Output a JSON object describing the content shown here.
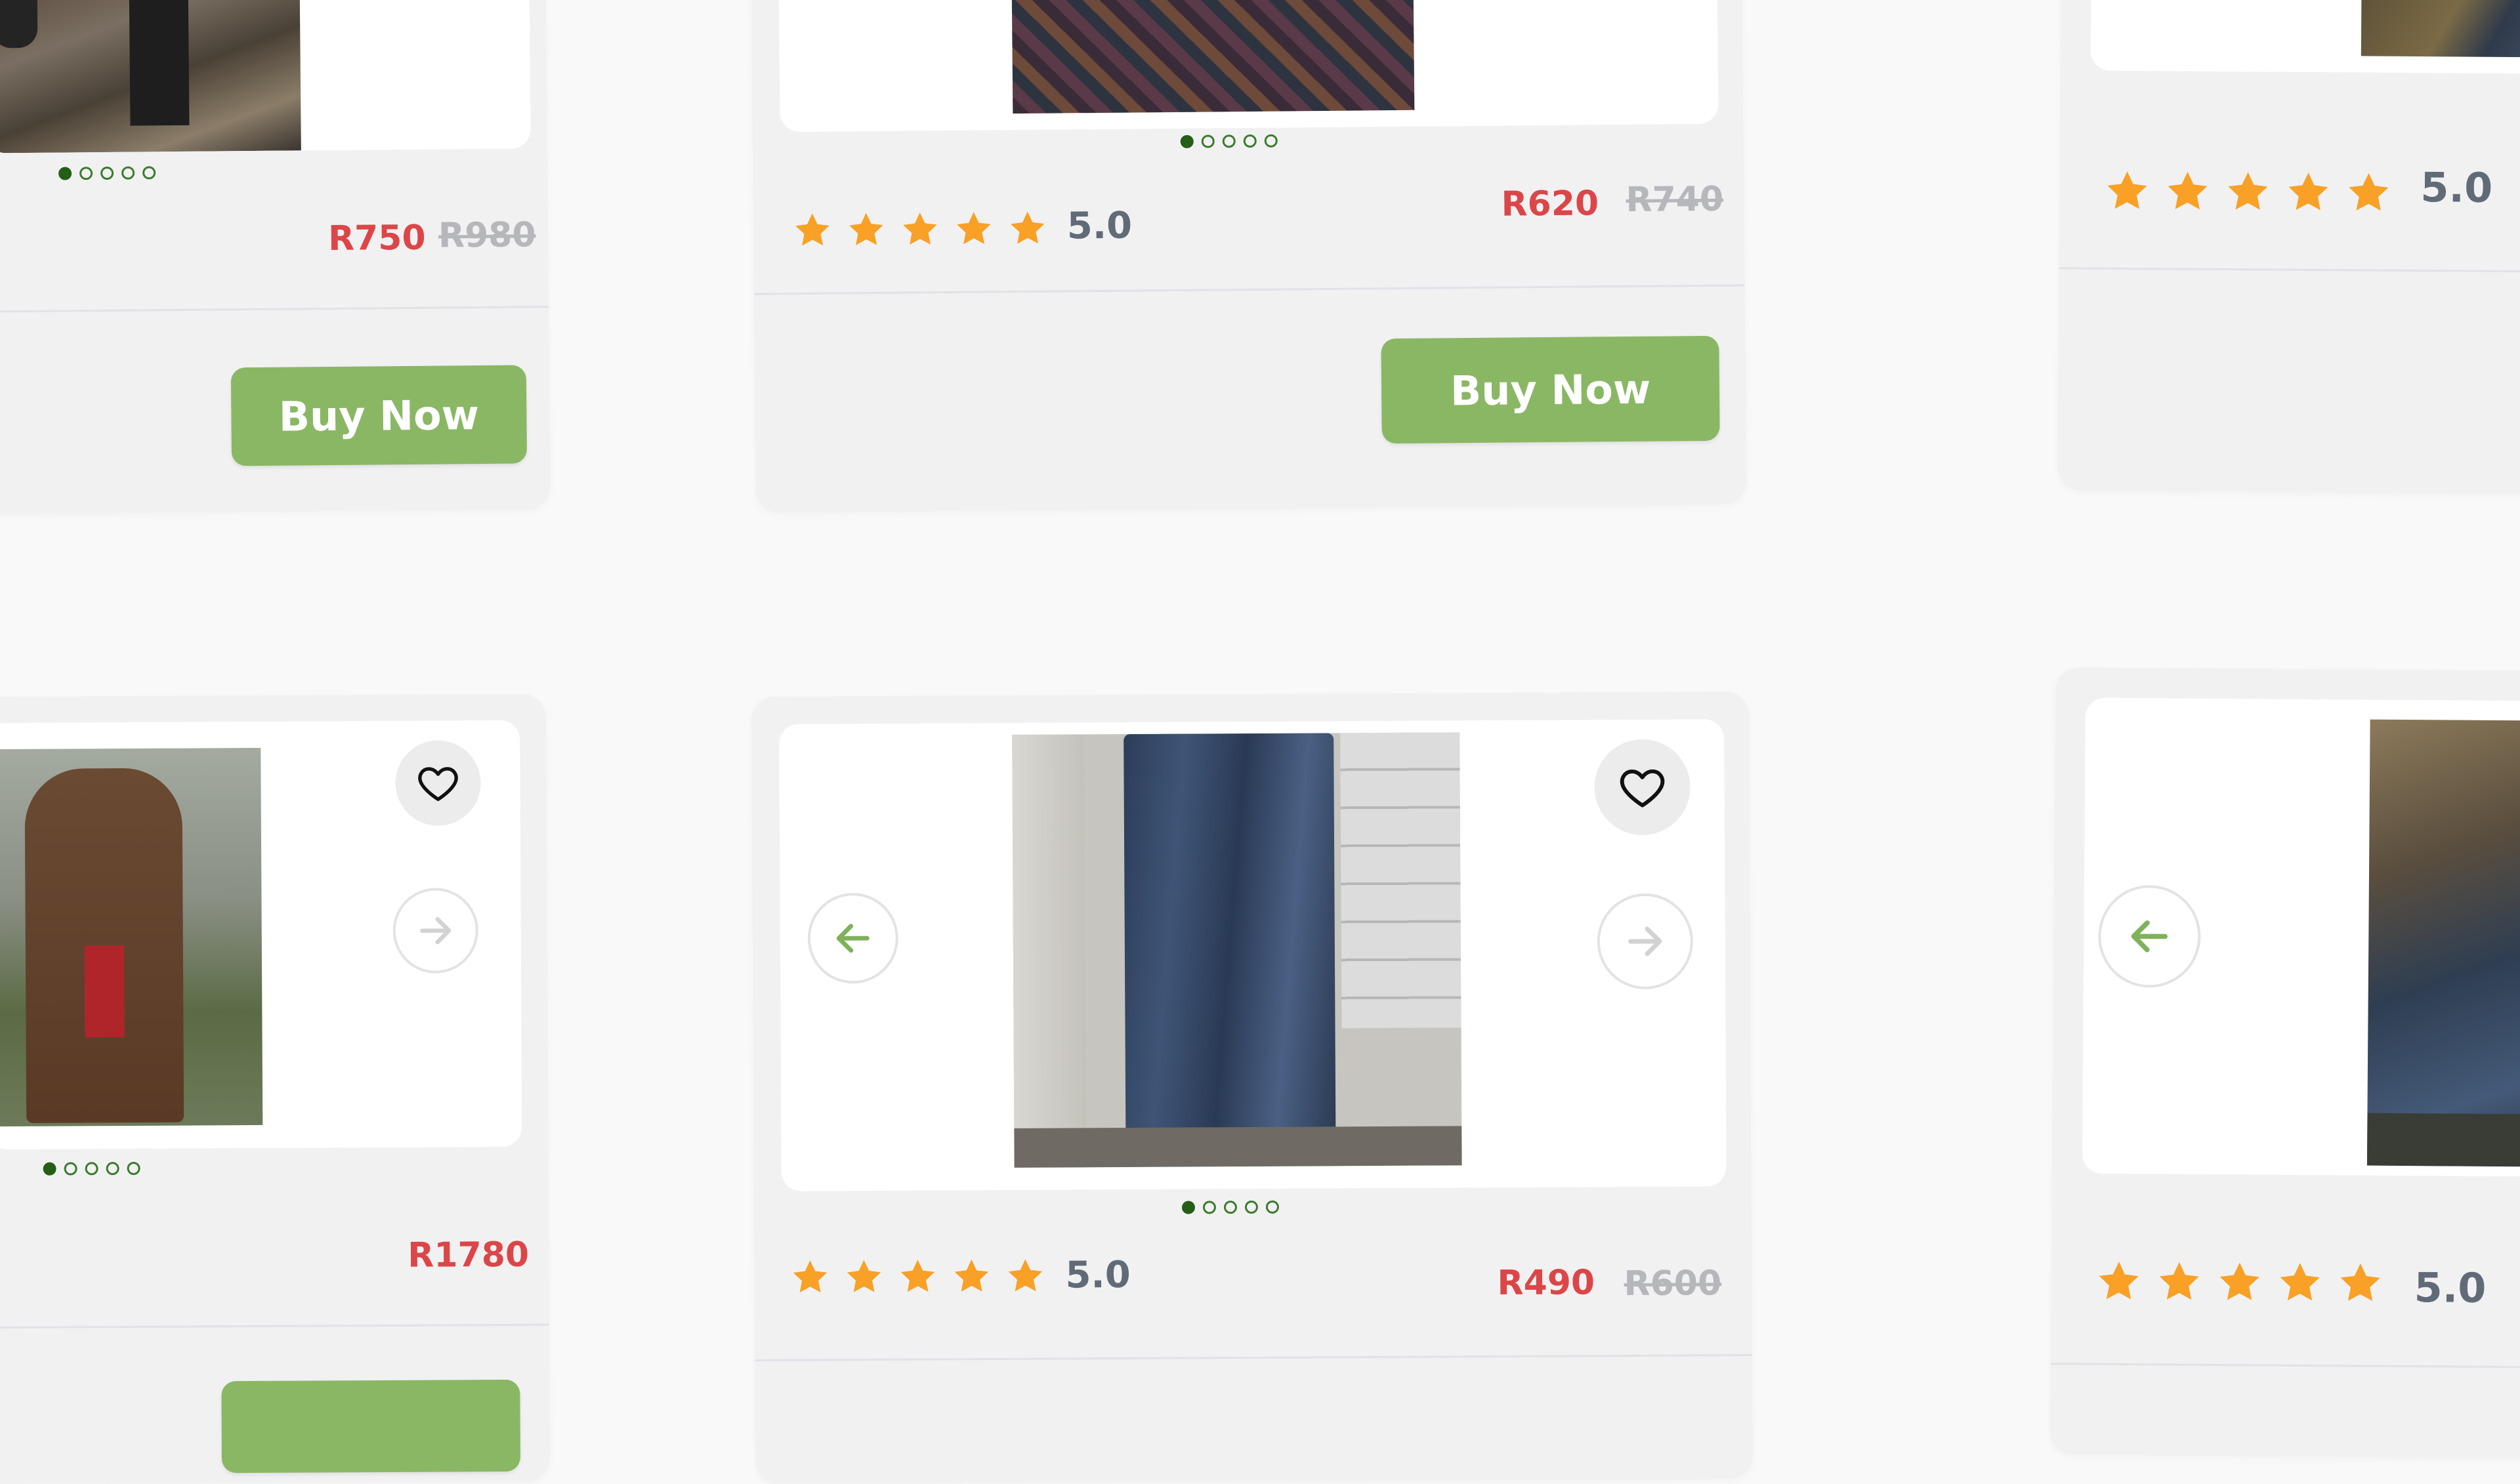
{
  "theme": {
    "background": "#f9f9f9",
    "card": "#f1f1f2",
    "accent_green": "#8ab764",
    "price_red": "#dc4648",
    "star_orange": "#f8a126"
  },
  "cards": {
    "top_left": {
      "price_new": "R750",
      "price_old": "R980",
      "buy_label": "Buy Now",
      "dots_active": 1
    },
    "top_center": {
      "rating": "5.0",
      "rating_stars": 5,
      "price_new": "R620",
      "price_old": "R740",
      "buy_label": "Buy Now",
      "dots_active": 1
    },
    "top_right": {
      "rating": "5.0",
      "rating_stars": 5
    },
    "bottom_left": {
      "price_new": "R1780",
      "dots_active": 1,
      "icons": [
        "heart-icon",
        "arrow-right-icon"
      ]
    },
    "bottom_center": {
      "rating": "5.0",
      "rating_stars": 5,
      "price_new": "R490",
      "price_old": "R600",
      "dots_active": 1,
      "icons": [
        "heart-icon",
        "arrow-left-icon",
        "arrow-right-icon"
      ]
    },
    "bottom_right": {
      "rating": "5.0",
      "rating_stars": 5,
      "icons": [
        "arrow-left-icon"
      ]
    }
  }
}
